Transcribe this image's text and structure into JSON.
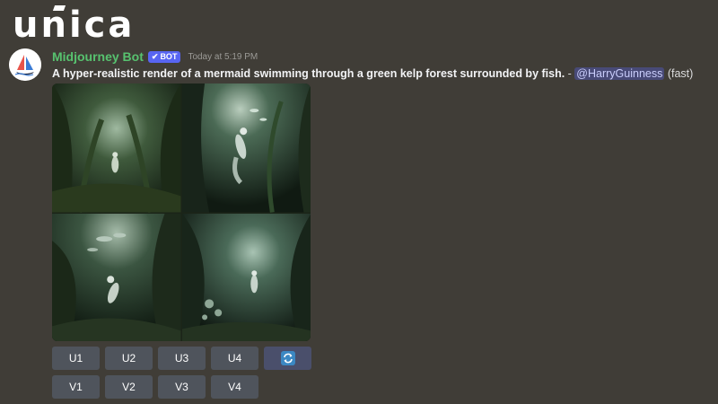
{
  "watermark": {
    "text": "unica"
  },
  "message": {
    "author": "Midjourney Bot",
    "badge": "BOT",
    "timestamp": "Today at 5:19 PM",
    "prompt": "A hyper-realistic render of a mermaid swimming through a green kelp forest surrounded by fish.",
    "separator": " - ",
    "mention": "@HarryGuinness",
    "mode": "(fast)"
  },
  "images": [
    {
      "icon": "mermaid-kelp-image-1"
    },
    {
      "icon": "mermaid-kelp-image-2"
    },
    {
      "icon": "mermaid-kelp-image-3"
    },
    {
      "icon": "mermaid-kelp-image-4"
    }
  ],
  "buttons": {
    "upscale": [
      "U1",
      "U2",
      "U3",
      "U4"
    ],
    "reroll_icon": "refresh-icon",
    "variation": [
      "V1",
      "V2",
      "V3",
      "V4"
    ]
  },
  "colors": {
    "background": "#403d37",
    "username": "#57c26f",
    "badge": "#5865f2",
    "button": "#4f545c",
    "reroll_button": "#4a4f6b"
  }
}
